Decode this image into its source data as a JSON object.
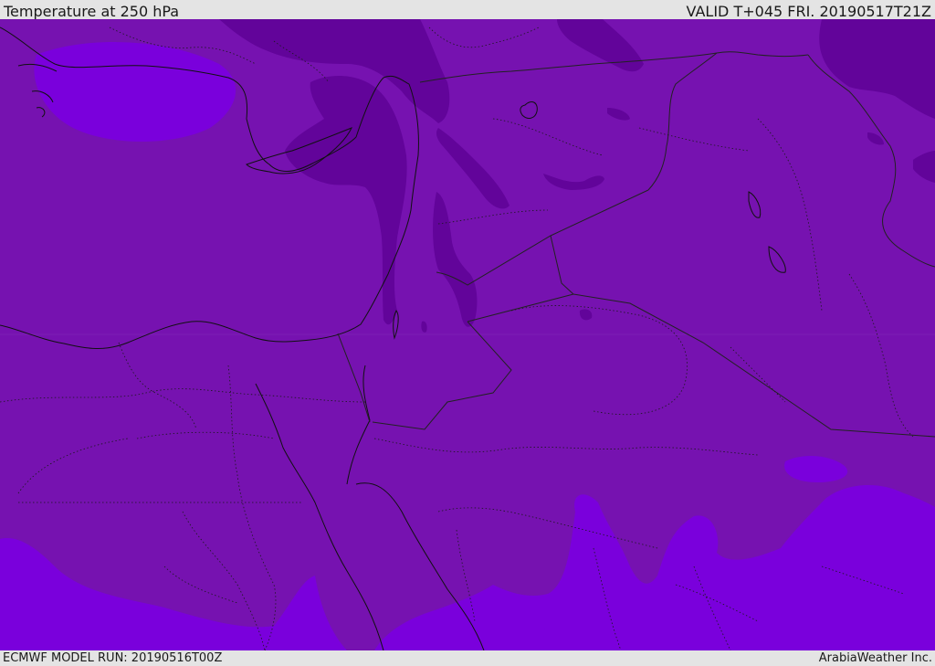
{
  "header": {
    "title": "Temperature at 250 hPa",
    "valid_time": "VALID T+045 FRI. 20190517T21Z"
  },
  "footer": {
    "model_run": "ECMWF MODEL RUN: 20190516T00Z",
    "credit": "ArabiaWeather Inc."
  },
  "colors": {
    "background_level": "#7612b0",
    "warm_level": "#7a00dc",
    "cold_level": "#62049a",
    "coastline": "#111111",
    "border": "#222222"
  }
}
